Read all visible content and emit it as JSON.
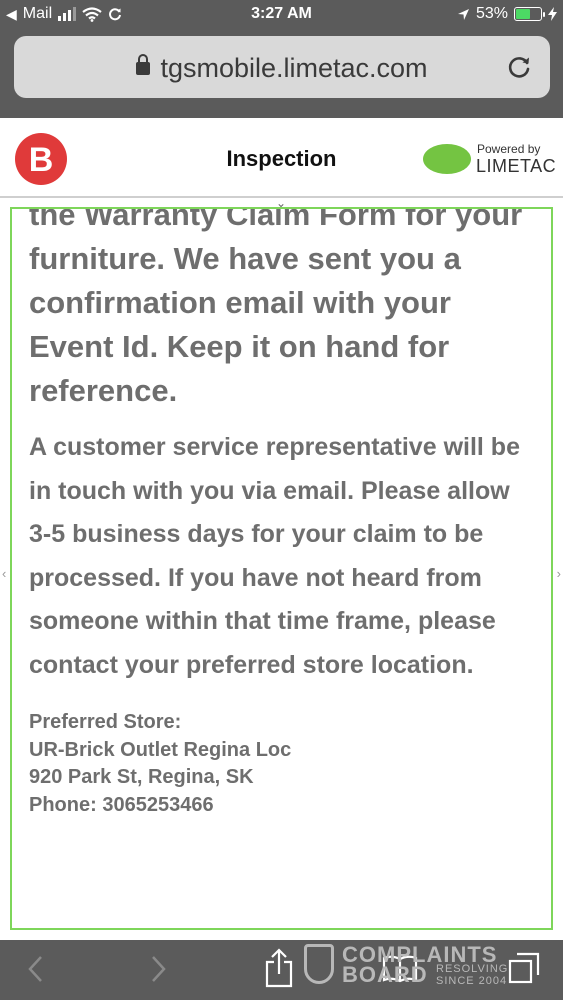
{
  "status_bar": {
    "carrier": "Mail",
    "time": "3:27 AM",
    "battery_percent": "53%",
    "battery_level": 0.53,
    "icons": [
      "back-to-app-icon",
      "signal-icon",
      "wifi-icon",
      "sync-icon",
      "location-icon",
      "battery-icon",
      "charging-icon"
    ]
  },
  "browser": {
    "url": "tgsmobile.limetac.com",
    "icons": [
      "lock-icon",
      "reload-icon"
    ]
  },
  "header": {
    "title": "Inspection",
    "powered_by_label": "Powered by",
    "powered_by_name": "LIMETAC",
    "brand_color": "#e03a3a",
    "limetac_color": "#74c442"
  },
  "content": {
    "confirmation_text": "the Warranty Claim Form for your furniture. We have sent you a confirmation email with your Event Id. Keep it on hand for reference.",
    "service_text": "A customer service representative will be in touch with you via email. Please allow 3-5 business days for your claim to be processed. If you have not heard from someone within that time frame, please contact your preferred store location.",
    "store_heading": "Preferred Store:",
    "store_name": "UR-Brick Outlet Regina Loc",
    "store_address": "920 Park St, Regina, SK",
    "store_phone": "Phone: 3065253466",
    "frame_color": "#7ed65a",
    "text_color": "#6e6e6e"
  },
  "toolbar": {
    "icons": [
      "back-arrow-icon",
      "forward-arrow-icon",
      "share-icon",
      "bookmarks-icon",
      "tabs-icon"
    ]
  },
  "watermark": {
    "line1": "COMPLAINTS",
    "line2": "BOARD",
    "line3": "RESOLVING",
    "line4": "SINCE 2004"
  }
}
